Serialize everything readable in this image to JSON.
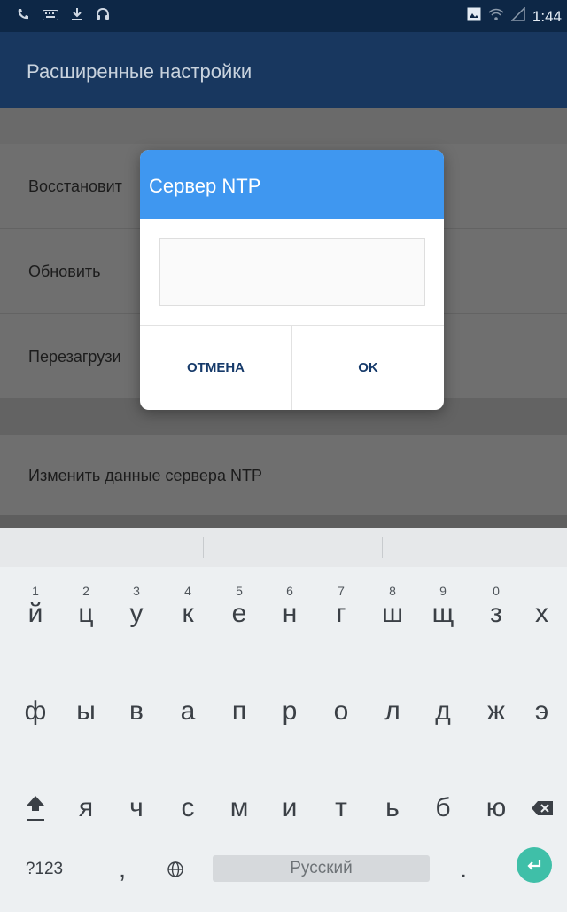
{
  "status_bar": {
    "left_icons": [
      "phone-icon",
      "keyboard-icon",
      "download-icon",
      "headset-icon"
    ],
    "right_icons": [
      "image-icon",
      "wifi-icon",
      "signal-icon"
    ],
    "time": "1:44"
  },
  "app_bar": {
    "title": "Расширенные настройки"
  },
  "settings": {
    "items": [
      "Восстановит",
      "Обновить",
      "Перезагрузи",
      "Изменить данные сервера NTP"
    ]
  },
  "dialog": {
    "title": "Сервер NTP",
    "input_value": "",
    "cancel_label": "ОТМЕНА",
    "ok_label": "OK"
  },
  "keyboard": {
    "row1": [
      {
        "key": "й",
        "hint": "1"
      },
      {
        "key": "ц",
        "hint": "2"
      },
      {
        "key": "у",
        "hint": "3"
      },
      {
        "key": "к",
        "hint": "4"
      },
      {
        "key": "е",
        "hint": "5"
      },
      {
        "key": "н",
        "hint": "6"
      },
      {
        "key": "г",
        "hint": "7"
      },
      {
        "key": "ш",
        "hint": "8"
      },
      {
        "key": "щ",
        "hint": "9"
      },
      {
        "key": "з",
        "hint": "0"
      },
      {
        "key": "х",
        "hint": ""
      }
    ],
    "row2": [
      "ф",
      "ы",
      "в",
      "а",
      "п",
      "р",
      "о",
      "л",
      "д",
      "ж",
      "э"
    ],
    "row3": [
      "я",
      "ч",
      "с",
      "м",
      "и",
      "т",
      "ь",
      "б",
      "ю"
    ],
    "symbols_label": "?123",
    "comma": ",",
    "period": ".",
    "space_label": "Русский",
    "accent_color": "#3fbfa8"
  }
}
